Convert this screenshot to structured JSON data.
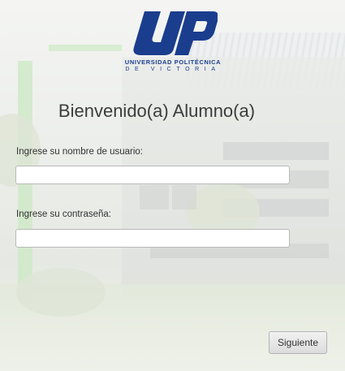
{
  "logo": {
    "mark": "UP",
    "university_line": "UNIVERSIDAD POLITÉCNICA",
    "city_line": "DE VICTORIA"
  },
  "login": {
    "title": "Bienvenido(a) Alumno(a)",
    "username_label": "Ingrese su nombre de usuario:",
    "username_value": "",
    "password_label": "Ingrese su contraseña:",
    "password_value": "",
    "next_button": "Siguiente"
  },
  "colors": {
    "brand_blue": "#1a3d8e"
  }
}
